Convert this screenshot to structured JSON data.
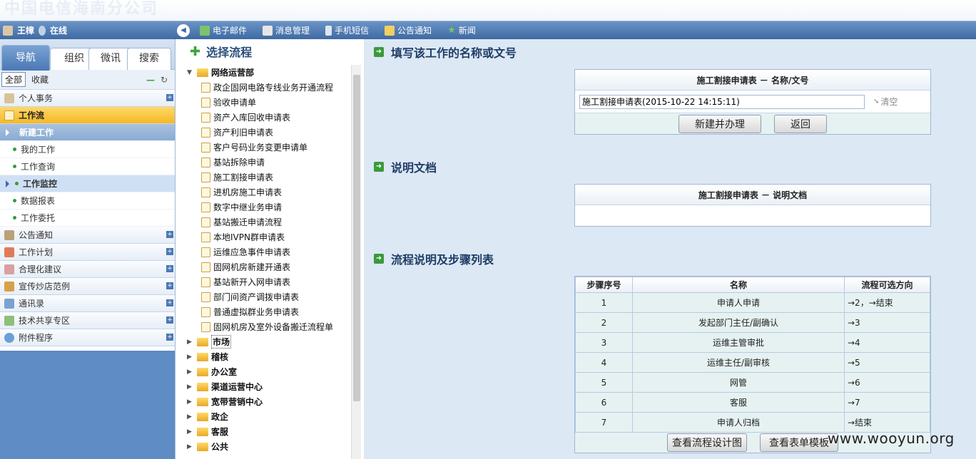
{
  "app": {
    "logo_text": "中国电信海南分公司"
  },
  "user": {
    "name": "王樟",
    "status": "在线"
  },
  "toolbar": {
    "items": [
      {
        "label": "电子邮件",
        "icon": "mail-icon"
      },
      {
        "label": "消息管理",
        "icon": "message-icon"
      },
      {
        "label": "手机短信",
        "icon": "phone-icon"
      },
      {
        "label": "公告通知",
        "icon": "speaker-icon"
      },
      {
        "label": "新闻",
        "icon": "news-icon"
      }
    ]
  },
  "sidebar": {
    "tabs": [
      "导航",
      "组织",
      "微讯",
      "搜索"
    ],
    "filters": {
      "all": "全部",
      "favorites": "收藏"
    },
    "sections": [
      {
        "label": "个人事务"
      },
      {
        "label": "工作流"
      },
      {
        "label": "公告通知"
      },
      {
        "label": "工作计划"
      },
      {
        "label": "合理化建议"
      },
      {
        "label": "宣传炒店范例"
      },
      {
        "label": "通讯录"
      },
      {
        "label": "技术共享专区"
      },
      {
        "label": "附件程序"
      }
    ],
    "workflow_items": [
      "新建工作",
      "我的工作",
      "工作查询",
      "工作监控",
      "数据报表",
      "工作委托"
    ]
  },
  "flow": {
    "title": "选择流程",
    "root": "网络运营部",
    "children": [
      "政企固网电路专线业务开通流程",
      "验收申请单",
      "资产入库回收申请表",
      "资产利旧申请表",
      "客户号码业务变更申请单",
      "基站拆除申请",
      "施工割接申请表",
      "进机房施工申请表",
      "数字中继业务申请",
      "基站搬迁申请流程",
      "本地IVPN群申请表",
      "运维应急事件申请表",
      "固网机房新建开通表",
      "基站新开入网申请表",
      "部门间资产调拨申请表",
      "普通虚拟群业务申请表",
      "固网机房及室外设备搬迁流程单"
    ],
    "folders": [
      "市场",
      "稽核",
      "办公室",
      "渠道运营中心",
      "宽带营销中心",
      "政企",
      "客服",
      "公共"
    ]
  },
  "main": {
    "section1_title": "填写该工作的名称或文号",
    "name_box_header": "施工割接申请表 － 名称/文号",
    "name_input_value": "施工割接申请表(2015-10-22 14:15:11)",
    "clear_label": "清空",
    "create_button": "新建并办理",
    "back_button": "返回",
    "section2_title": "说明文档",
    "doc_box_header": "施工割接申请表 － 说明文档",
    "section3_title": "流程说明及步骤列表",
    "steps_headers": [
      "步骤序号",
      "名称",
      "流程可选方向"
    ],
    "steps": [
      {
        "no": "1",
        "name": "申请人申请",
        "dir": "→2，→结束"
      },
      {
        "no": "2",
        "name": "发起部门主任/副确认",
        "dir": "→3"
      },
      {
        "no": "3",
        "name": "运维主管审批",
        "dir": "→4"
      },
      {
        "no": "4",
        "name": "运维主任/副审核",
        "dir": "→5"
      },
      {
        "no": "5",
        "name": "网管",
        "dir": "→6"
      },
      {
        "no": "6",
        "name": "客服",
        "dir": "→7"
      },
      {
        "no": "7",
        "name": "申请人归档",
        "dir": "→结束"
      }
    ],
    "view_design_button": "查看流程设计图",
    "view_form_button": "查看表单模板"
  },
  "watermark": "www.wooyun.org"
}
